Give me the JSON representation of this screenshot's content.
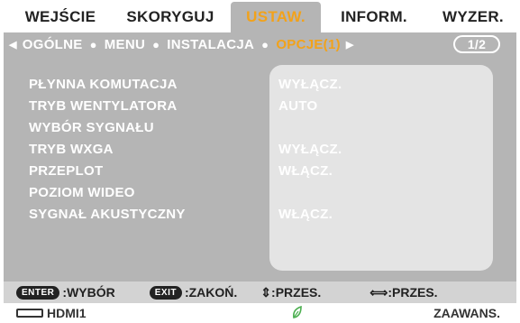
{
  "tabs": [
    {
      "label": "WEJŚCIE"
    },
    {
      "label": "SKORYGUJ"
    },
    {
      "label": "USTAW."
    },
    {
      "label": "INFORM."
    },
    {
      "label": "WYZER."
    }
  ],
  "active_tab": "USTAW.",
  "subnav": {
    "items": [
      "OGÓLNE",
      "MENU",
      "INSTALACJA",
      "OPCJE(1)"
    ],
    "selected": "OPCJE(1)",
    "page": "1/2"
  },
  "settings": [
    {
      "label": "PŁYNNA KOMUTACJA",
      "value": "WYŁĄCZ."
    },
    {
      "label": "TRYB WENTYLATORA",
      "value": "AUTO"
    },
    {
      "label": "WYBÓR SYGNAŁU",
      "value": ""
    },
    {
      "label": "TRYB WXGA",
      "value": "WYŁĄCZ."
    },
    {
      "label": "PRZEPLOT",
      "value": "WŁĄCZ."
    },
    {
      "label": "POZIOM WIDEO",
      "value": ""
    },
    {
      "label": "SYGNAŁ AKUSTYCZNY",
      "value": "WŁĄCZ."
    }
  ],
  "help": {
    "enter_key": "ENTER",
    "enter_text": ":WYBÓR",
    "exit_key": "EXIT",
    "exit_text": ":ZAKOŃ.",
    "updown_text": "⇕:PRZES.",
    "leftright_text": "⟺:PRZES."
  },
  "status": {
    "source": "HDMI1",
    "mode": "ZAAWANS."
  },
  "colors": {
    "panel": "#b5b5b5",
    "accent": "#f2a21a",
    "value_bg": "#e4e4e4",
    "leaf": "#4caf50"
  }
}
